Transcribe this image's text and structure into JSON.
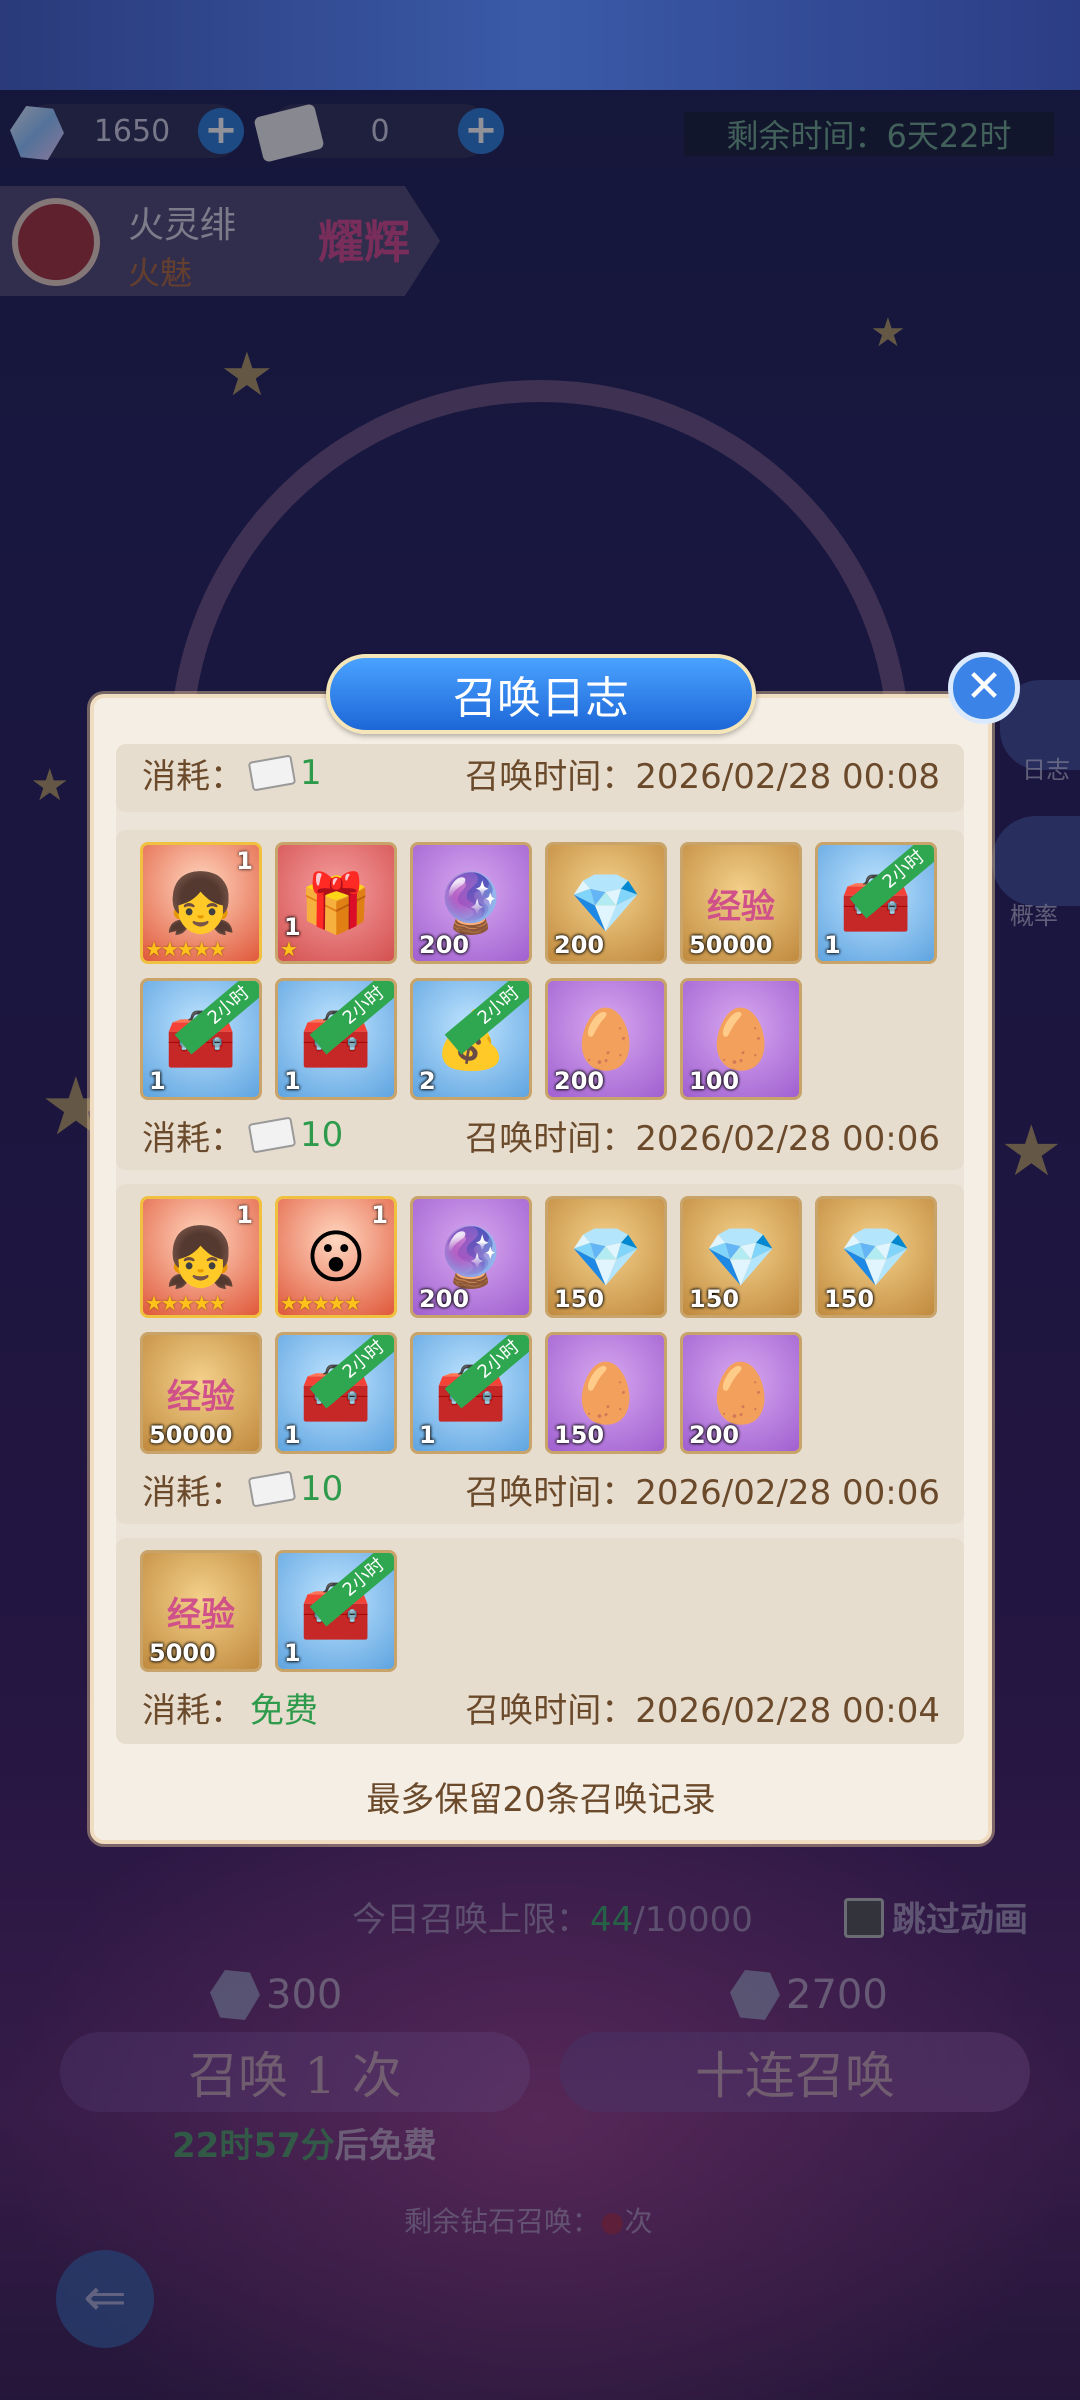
{
  "top": {
    "diamonds": "1650",
    "tickets": "0",
    "timer_label": "剩余时间：",
    "timer_value": "6天22时"
  },
  "hero": {
    "name": "火灵绯",
    "subtitle": "火魅",
    "badge": "耀辉"
  },
  "side": {
    "log": "日志",
    "rate": "概率"
  },
  "bottom": {
    "daily_limit_label": "今日召唤上限：",
    "daily_used": "44",
    "daily_max": "/10000",
    "skip_animation": "跳过动画",
    "cost_single": "300",
    "cost_ten": "2700",
    "summon_once": "召唤 1 次",
    "summon_ten": "十连召唤",
    "free_in_time": "22时57分",
    "free_in_suffix": "后免费",
    "remaining_label": "剩余钻石召唤：",
    "remaining_suffix": "次"
  },
  "modal": {
    "title": "召唤日志",
    "cost_label": "消耗：",
    "time_label": "召唤时间：",
    "footer_note": "最多保留20条召唤记录",
    "records": [
      {
        "cost": "1",
        "time": "2026/02/28 00:08",
        "items": []
      },
      {
        "cost": "10",
        "time": "2026/02/28 00:06",
        "items": [
          {
            "type": "hero",
            "qty": "1",
            "stars": "★★★★★"
          },
          {
            "type": "mystery-box",
            "qty": "1",
            "stars": "★"
          },
          {
            "type": "crystal-orb",
            "qty": "200"
          },
          {
            "type": "diamond",
            "qty": "200"
          },
          {
            "type": "exp-heart",
            "qty": "50000",
            "label": "经验"
          },
          {
            "type": "chest-2h",
            "qty": "1",
            "ribbon": "2小时"
          },
          {
            "type": "chest-2h",
            "qty": "1",
            "ribbon": "2小时"
          },
          {
            "type": "chest-2h",
            "qty": "1",
            "ribbon": "2小时"
          },
          {
            "type": "gold-chest-2h",
            "qty": "2",
            "ribbon": "2小时"
          },
          {
            "type": "egg",
            "qty": "200"
          },
          {
            "type": "egg",
            "qty": "100"
          }
        ]
      },
      {
        "cost": "10",
        "time": "2026/02/28 00:06",
        "items": [
          {
            "type": "hero",
            "qty": "1",
            "stars": "★★★★★"
          },
          {
            "type": "hero2",
            "qty": "1",
            "stars": "★★★★★"
          },
          {
            "type": "crystal-orb",
            "qty": "200"
          },
          {
            "type": "diamond",
            "qty": "150"
          },
          {
            "type": "diamond",
            "qty": "150"
          },
          {
            "type": "diamond",
            "qty": "150"
          },
          {
            "type": "exp-heart",
            "qty": "50000",
            "label": "经验"
          },
          {
            "type": "chest-2h",
            "qty": "1",
            "ribbon": "2小时"
          },
          {
            "type": "chest-2h",
            "qty": "1",
            "ribbon": "2小时"
          },
          {
            "type": "egg",
            "qty": "150"
          },
          {
            "type": "egg",
            "qty": "200"
          }
        ]
      },
      {
        "cost": "免费",
        "time": "2026/02/28 00:04",
        "items": [
          {
            "type": "exp-heart",
            "qty": "5000",
            "label": "经验"
          },
          {
            "type": "chest-2h",
            "qty": "1",
            "ribbon": "2小时"
          }
        ]
      }
    ]
  }
}
